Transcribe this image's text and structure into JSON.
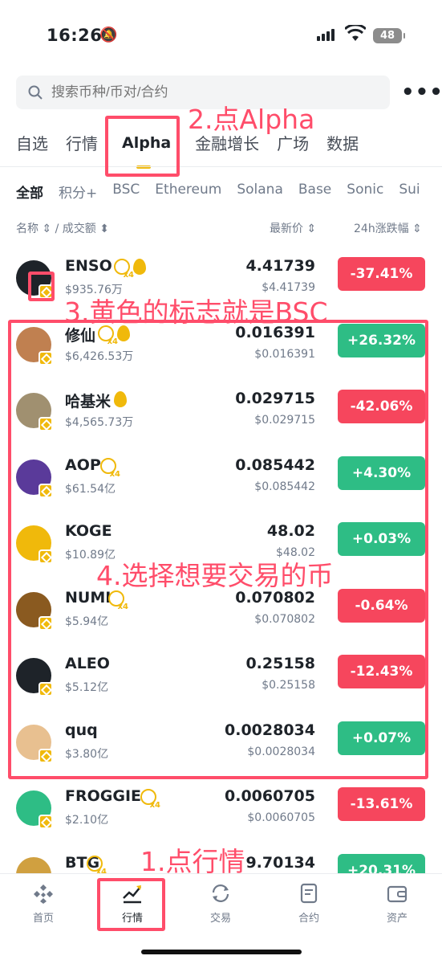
{
  "status_bar": {
    "time": "16:26",
    "battery": "48"
  },
  "search": {
    "placeholder": "搜索币种/币对/合约"
  },
  "top_tabs": [
    "自选",
    "行情",
    "Alpha",
    "金融增长",
    "广场",
    "数据"
  ],
  "sub_tabs": [
    "全部",
    "积分+",
    "BSC",
    "Ethereum",
    "Solana",
    "Base",
    "Sonic",
    "Sui"
  ],
  "list_header": {
    "name": "名称 ⇕ / 成交额 ⬍",
    "price": "最新价 ⇕",
    "change": "24h涨跌幅 ⇕"
  },
  "coins": [
    {
      "name": "ENSO",
      "volume": "$935.76万",
      "price": "4.41739",
      "price_usd": "$4.41739",
      "change": "-37.41%",
      "direction": "down"
    },
    {
      "name": "修仙",
      "volume": "$6,426.53万",
      "price": "0.016391",
      "price_usd": "$0.016391",
      "change": "+26.32%",
      "direction": "up"
    },
    {
      "name": "哈基米",
      "volume": "$4,565.73万",
      "price": "0.029715",
      "price_usd": "$0.029715",
      "change": "-42.06%",
      "direction": "down"
    },
    {
      "name": "AOP",
      "volume": "$61.54亿",
      "price": "0.085442",
      "price_usd": "$0.085442",
      "change": "+4.30%",
      "direction": "up"
    },
    {
      "name": "KOGE",
      "volume": "$10.89亿",
      "price": "48.02",
      "price_usd": "$48.02",
      "change": "+0.03%",
      "direction": "up"
    },
    {
      "name": "NUMI",
      "volume": "$5.94亿",
      "price": "0.070802",
      "price_usd": "$0.070802",
      "change": "-0.64%",
      "direction": "down"
    },
    {
      "name": "ALEO",
      "volume": "$5.12亿",
      "price": "0.25158",
      "price_usd": "$0.25158",
      "change": "-12.43%",
      "direction": "down"
    },
    {
      "name": "quq",
      "volume": "$3.80亿",
      "price": "0.0028034",
      "price_usd": "$0.0028034",
      "change": "+0.07%",
      "direction": "up"
    },
    {
      "name": "FROGGIE",
      "volume": "$2.10亿",
      "price": "0.0060705",
      "price_usd": "$0.0060705",
      "change": "-13.61%",
      "direction": "down"
    },
    {
      "name": "BTG",
      "volume": "",
      "price": "9.70134",
      "price_usd": "",
      "change": "+20.31%",
      "direction": "up"
    }
  ],
  "annotations": {
    "a1": "1.点行情",
    "a2": "2.点Alpha",
    "a3": "3.黄色的标志就是BSC",
    "a4": "4.选择想要交易的币"
  },
  "bottom_nav": [
    "首页",
    "行情",
    "交易",
    "合约",
    "资产"
  ],
  "colors": {
    "accent": "#f0b90b",
    "up": "#2ebd85",
    "down": "#f6465d",
    "annotation": "#ff4d6a"
  }
}
